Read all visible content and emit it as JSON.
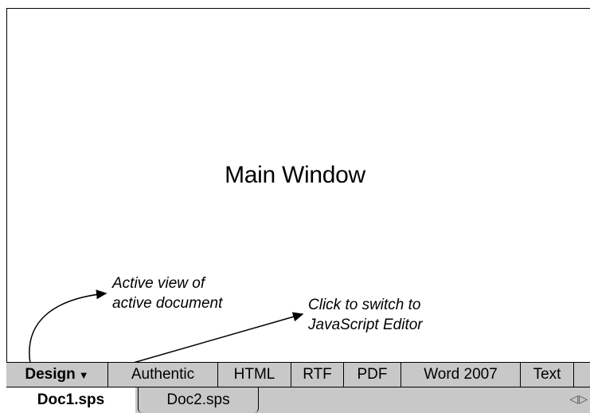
{
  "main": {
    "title": "Main Window"
  },
  "annotations": {
    "active_view": [
      "Active view of",
      "active document"
    ],
    "switch_editor": [
      "Click to switch to",
      "JavaScript Editor"
    ]
  },
  "view_tabs": [
    {
      "label": "Design",
      "active": true,
      "has_dropdown": true
    },
    {
      "label": "Authentic"
    },
    {
      "label": "HTML"
    },
    {
      "label": "RTF"
    },
    {
      "label": "PDF"
    },
    {
      "label": "Word 2007"
    },
    {
      "label": "Text"
    }
  ],
  "dropdown_glyph": "▼",
  "doc_tabs": [
    {
      "label": "Doc1.sps",
      "active": true
    },
    {
      "label": "Doc2.sps"
    }
  ],
  "scroll": {
    "left": "◁",
    "right": "▷"
  },
  "colors": {
    "bar_bg": "#c8c8c8",
    "active_doc_bg": "#ffffff"
  }
}
